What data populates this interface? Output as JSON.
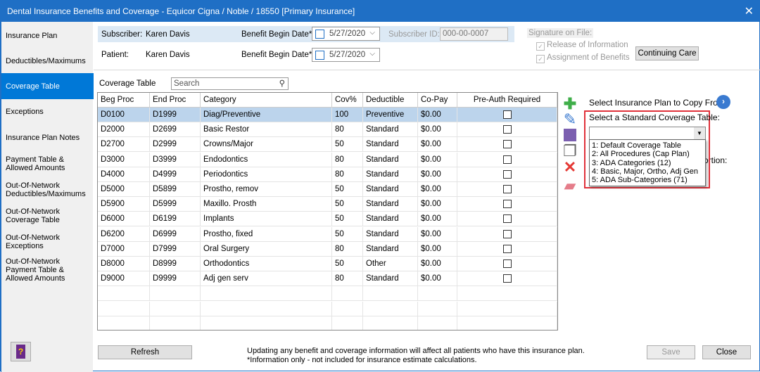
{
  "window": {
    "title": "Dental Insurance Benefits and Coverage - Equicor Cigna / Noble / 18550 [Primary Insurance]",
    "close": "✕"
  },
  "sidebar": {
    "items": [
      {
        "label": "Insurance Plan"
      },
      {
        "label": "Deductibles/Maximums"
      },
      {
        "label": "Coverage Table",
        "selected": true
      },
      {
        "label": "Exceptions"
      },
      {
        "label": "Insurance Plan Notes"
      },
      {
        "label": "Payment Table & Allowed Amounts"
      },
      {
        "label": "Out-Of-Network Deductibles/Maximums"
      },
      {
        "label": "Out-Of-Network Coverage Table"
      },
      {
        "label": "Out-Of-Network Exceptions"
      },
      {
        "label": "Out-Of-Network Payment Table & Allowed Amounts"
      }
    ]
  },
  "header": {
    "subscriber_label": "Subscriber:",
    "subscriber": "Karen Davis",
    "patient_label": "Patient:",
    "patient": "Karen Davis",
    "benefit_label": "Benefit Begin Date*",
    "subscriber_date": "5/27/2020",
    "patient_date": "5/27/2020",
    "subscriber_id_label": "Subscriber ID:",
    "subscriber_id": "000-00-0007",
    "signature_label": "Signature on File:",
    "release": "Release of Information",
    "assignment": "Assignment of Benefits",
    "continuing_care": "Continuing Care"
  },
  "coverage": {
    "label": "Coverage Table",
    "search_placeholder": "Search",
    "columns": [
      "Beg Proc",
      "End Proc",
      "Category",
      "Cov%",
      "Deductible",
      "Co-Pay",
      "Pre-Auth Required"
    ],
    "rows": [
      [
        "D0100",
        "D1999",
        "Diag/Preventive",
        "100",
        "Preventive",
        "$0.00"
      ],
      [
        "D2000",
        "D2699",
        "Basic Restor",
        "80",
        "Standard",
        "$0.00"
      ],
      [
        "D2700",
        "D2999",
        "Crowns/Major",
        "50",
        "Standard",
        "$0.00"
      ],
      [
        "D3000",
        "D3999",
        "Endodontics",
        "80",
        "Standard",
        "$0.00"
      ],
      [
        "D4000",
        "D4999",
        "Periodontics",
        "80",
        "Standard",
        "$0.00"
      ],
      [
        "D5000",
        "D5899",
        "Prostho, remov",
        "50",
        "Standard",
        "$0.00"
      ],
      [
        "D5900",
        "D5999",
        "Maxillo. Prosth",
        "50",
        "Standard",
        "$0.00"
      ],
      [
        "D6000",
        "D6199",
        "Implants",
        "50",
        "Standard",
        "$0.00"
      ],
      [
        "D6200",
        "D6999",
        "Prostho, fixed",
        "50",
        "Standard",
        "$0.00"
      ],
      [
        "D7000",
        "D7999",
        "Oral Surgery",
        "80",
        "Standard",
        "$0.00"
      ],
      [
        "D8000",
        "D8999",
        "Orthodontics",
        "50",
        "Other",
        "$0.00"
      ],
      [
        "D9000",
        "D9999",
        "Adj gen serv",
        "80",
        "Standard",
        "$0.00"
      ]
    ]
  },
  "right": {
    "copy_label": "Select Insurance Plan to Copy From:",
    "standard_label": "Select a Standard Coverage Table:",
    "hidden_label": "Portion:",
    "options": [
      "1: Default Coverage Table",
      "2: All Procedures (Cap Plan)",
      "3: ADA Categories (12)",
      "4: Basic, Major, Ortho, Adj Gen",
      "5: ADA Sub-Categories (71)"
    ]
  },
  "footer": {
    "refresh": "Refresh",
    "note1": "Updating any benefit and coverage information will affect all patients who have this insurance plan.",
    "note2": "*Information only - not included for insurance estimate calculations.",
    "save": "Save",
    "close": "Close"
  }
}
